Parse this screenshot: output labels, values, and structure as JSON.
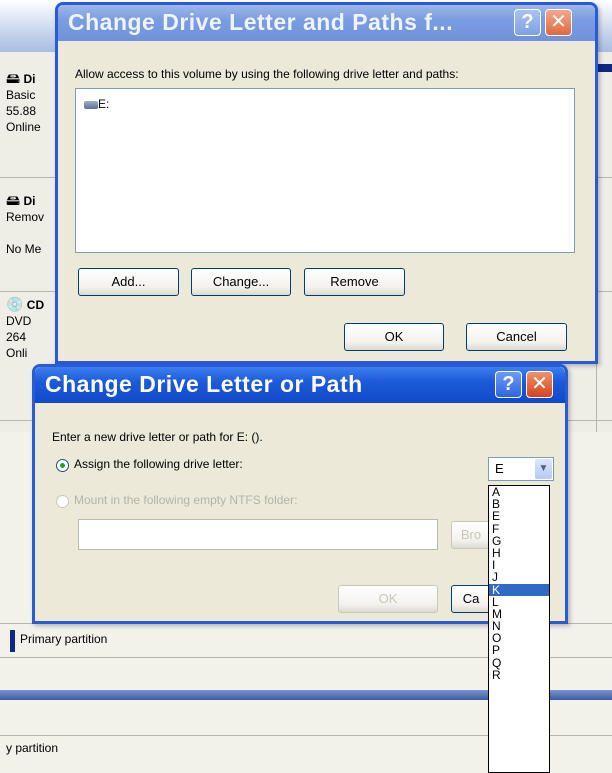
{
  "background": {
    "disks": [
      {
        "icon": "hard-disk-icon",
        "title": "Di",
        "lines": [
          "Basic",
          "55.88",
          "Online"
        ]
      },
      {
        "icon": "removable-disk-icon",
        "title": "Di",
        "lines": [
          "Remov",
          "",
          "No Me"
        ]
      },
      {
        "icon": "cd-drive-icon",
        "title": "CD",
        "lines": [
          "DVD",
          "264",
          "Onli"
        ]
      }
    ],
    "partition_label_1": "Primary partition",
    "partition_label_2": "y partition"
  },
  "paths_dialog": {
    "title": "Change Drive Letter and Paths f...",
    "help_label": "?",
    "close_label": "✕",
    "description": "Allow access to this volume by using the following drive letter and paths:",
    "list_items": [
      {
        "icon": "drive-icon",
        "label": "E:"
      }
    ],
    "buttons": {
      "add": "Add...",
      "change": "Change...",
      "remove": "Remove",
      "ok": "OK",
      "cancel": "Cancel"
    }
  },
  "change_dialog": {
    "title": "Change Drive Letter or Path",
    "help_label": "?",
    "close_label": "✕",
    "prompt": "Enter a new drive letter or path for E: ().",
    "option_assign": "Assign the following drive letter:",
    "option_mount": "Mount in the following empty NTFS folder:",
    "assign_selected": true,
    "folder_path_value": "",
    "browse_label": "Bro",
    "ok_label": "OK",
    "cancel_label": "Ca",
    "combo_value": "E",
    "dropdown_options": [
      "A",
      "B",
      "E",
      "F",
      "G",
      "H",
      "I",
      "J",
      "K",
      "L",
      "M",
      "N",
      "O",
      "P",
      "Q",
      "R"
    ],
    "dropdown_selected": "K"
  }
}
